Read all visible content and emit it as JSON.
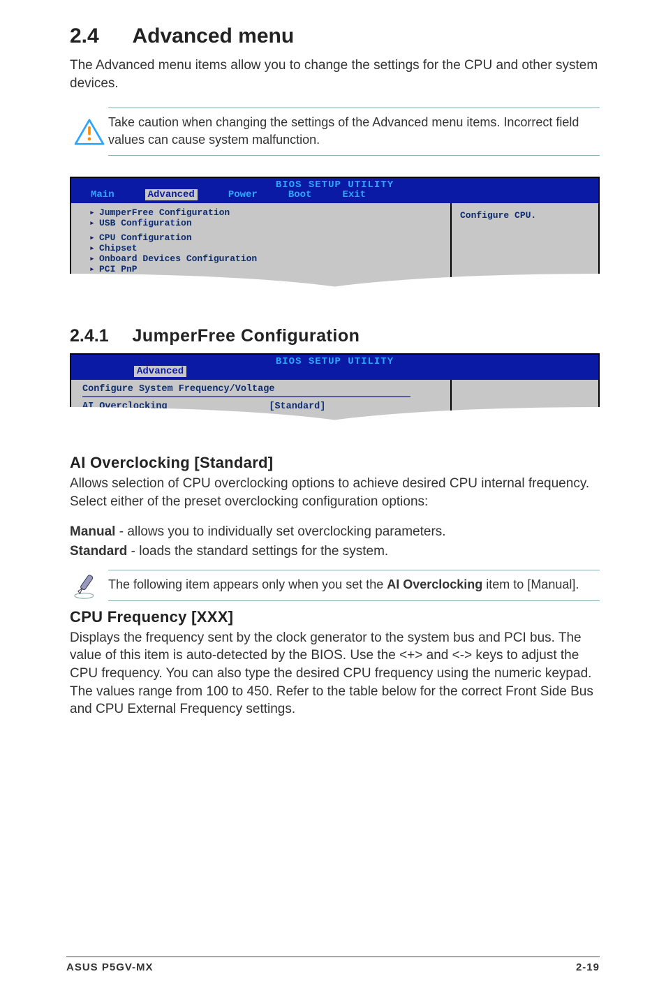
{
  "h1": {
    "num": "2.4",
    "text": "Advanced menu"
  },
  "intro": "The Advanced menu items allow you to change the settings for the CPU and other system devices.",
  "warn": "Take caution when changing the settings of the Advanced menu items. Incorrect field values can cause system malfunction.",
  "bios1": {
    "title": "BIOS SETUP UTILITY",
    "tabs": {
      "main": "Main",
      "advanced": "Advanced",
      "power": "Power",
      "boot": "Boot",
      "exit": "Exit"
    },
    "left": {
      "i1": "JumperFree Configuration",
      "i2": "USB Configuration",
      "i3": "CPU Configuration",
      "i4": "Chipset",
      "i5": "Onboard Devices Configuration",
      "i6": "PCI PnP"
    },
    "right": "Configure CPU."
  },
  "h2": {
    "num": "2.4.1",
    "text": "JumperFree Configuration"
  },
  "bios2": {
    "title": "BIOS SETUP UTILITY",
    "tab": "Advanced",
    "header": "Configure System Frequency/Voltage",
    "rowLabel": "AI Overclocking",
    "rowValue": "[Standard]"
  },
  "ai": {
    "h3": "AI Overclocking [Standard]",
    "p": "Allows selection of CPU overclocking options to achieve desired CPU internal frequency. Select either of the preset overclocking configuration options:",
    "manualLabel": "Manual",
    "manualText": " - allows you to individually set overclocking parameters.",
    "stdLabel": "Standard",
    "stdText": " - loads the standard settings for the system."
  },
  "note": {
    "pre": "The following item appears only when you set the ",
    "bold": "AI Overclocking",
    "post": " item to [Manual]."
  },
  "cpu": {
    "h3": "CPU Frequency [XXX]",
    "p": "Displays the frequency sent by the clock generator to the system bus and PCI bus. The value of this item is auto-detected by the BIOS. Use the <+> and <-> keys to adjust the CPU frequency. You can also type the desired CPU frequency using the numeric keypad. The values range from 100 to 450. Refer to the table below for the correct Front Side Bus and CPU External Frequency settings."
  },
  "footer": {
    "left": "ASUS P5GV-MX",
    "right": "2-19"
  }
}
